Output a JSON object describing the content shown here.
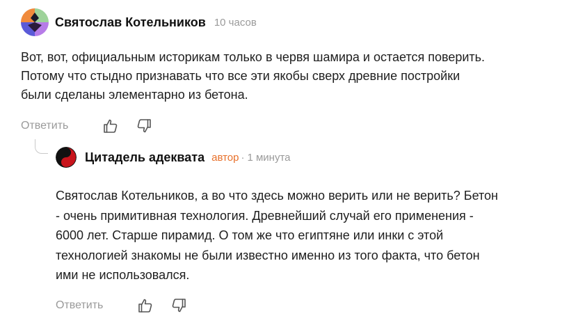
{
  "comments": [
    {
      "author": "Святослав Котельников",
      "time": "10 часов",
      "avatar_icon": "colorful-avatar-icon",
      "text_lines": [
        "Вот, вот, официальным историкам только в червя шамира и остается поверить.",
        "Потому что стыдно признавать что все эти якобы сверх древние постройки",
        "были сделаны элементарно из бетона."
      ],
      "reply_label": "Ответить"
    },
    {
      "author": "Цитадель адеквата",
      "badge": "автор",
      "separator": "·",
      "time": "1 минута",
      "avatar_icon": "yin-yang-avatar-icon",
      "text_lines": [
        "Святослав Котельников, а во что здесь можно верить или не верить? Бетон",
        "- очень примитивная технология. Древнейший случай его применения -",
        "6000 лет. Старше пирамид. О том же что египтяне или инки с этой",
        "технологией знакомы не были известно именно из того факта, что бетон",
        "ими не использовался."
      ],
      "reply_label": "Ответить"
    }
  ],
  "icons": {
    "like": "thumbs-up-icon",
    "dislike": "thumbs-down-icon"
  },
  "colors": {
    "author_badge": "#e8702a",
    "muted_text": "#9a9a9a"
  }
}
